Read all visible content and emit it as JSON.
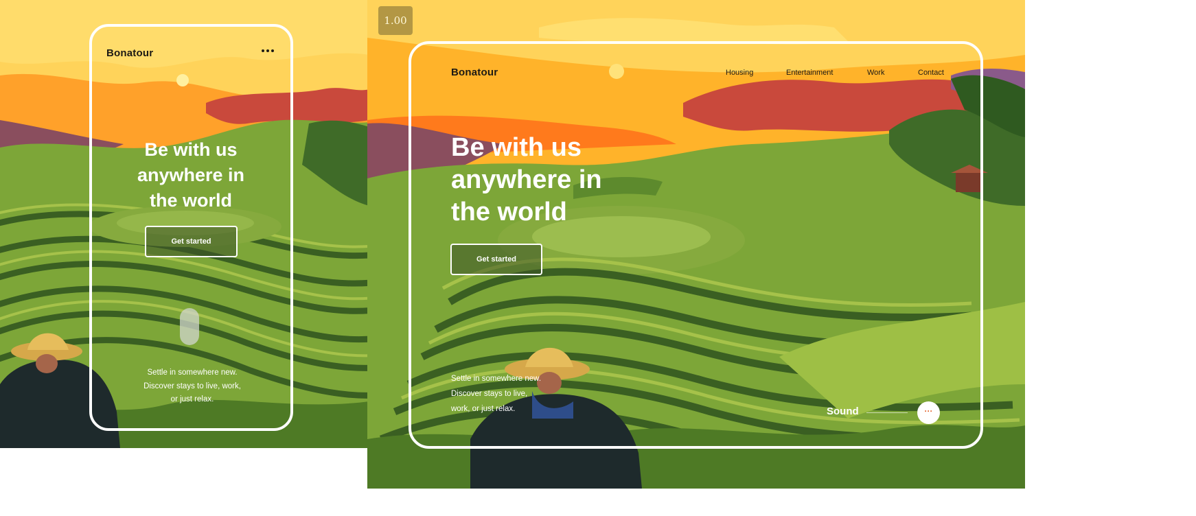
{
  "mobile": {
    "brand": "Bonatour",
    "menu_icon": "more-horizontal-icon",
    "hero": {
      "line1": "Be with us",
      "line2": "anywhere in",
      "line3": "the world"
    },
    "cta_label": "Get started",
    "scroll_indicator_icon": "scroll-pill-icon",
    "description": "Settle in somewhere new. Discover stays to live, work, or just relax."
  },
  "desktop": {
    "brand": "Bonatour",
    "nav": [
      "Housing",
      "Entertainment",
      "Work",
      "Contact"
    ],
    "hero": {
      "line1": "Be with us",
      "line2": "anywhere in",
      "line3": "the world"
    },
    "cta_label": "Get started",
    "description": "Settle in somewhere new. Discover stays to live, work, or just relax.",
    "sound_label": "Sound",
    "sound_button_glyph": "···",
    "sound_button_icon": "more-horizontal-icon"
  },
  "zoom_level": "1.00",
  "colors": {
    "sky": "#ffd35a",
    "sunset_orange": "#ff8a1f",
    "cloud_red": "#c9493c",
    "mountain_purple": "#8a4e5e",
    "field_green": "#7da638",
    "dark_green": "#2d4a1f",
    "accent_orange": "#e2602a",
    "frame_white": "#ffffff"
  }
}
